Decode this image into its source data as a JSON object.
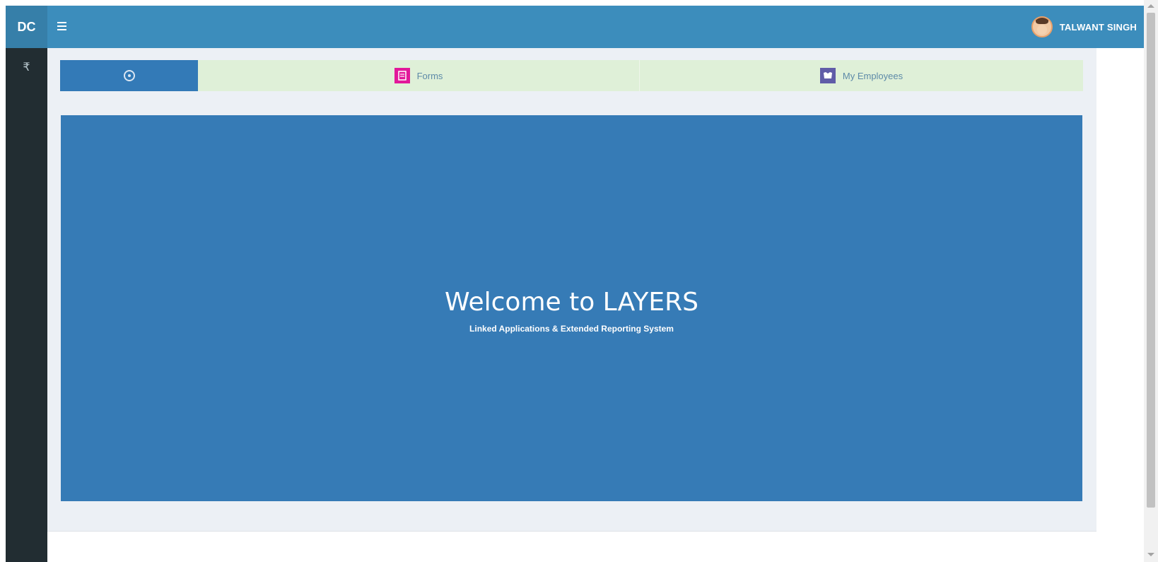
{
  "brand": {
    "logo": "DC"
  },
  "sidebar": {
    "items": [
      {
        "icon": "rupee-icon",
        "label": "₹"
      }
    ]
  },
  "topbar": {
    "menu_icon": "hamburger-icon",
    "user": {
      "name": "TALWANT SINGH",
      "avatar_icon": "user-avatar"
    }
  },
  "tabs": [
    {
      "icon": "dashboard-icon",
      "label": "",
      "active": true
    },
    {
      "icon": "form-icon",
      "label": "Forms",
      "icon_color": "#e2189a"
    },
    {
      "icon": "employees-icon",
      "label": "My Employees",
      "icon_color": "#605ca8"
    }
  ],
  "hero": {
    "title": "Welcome to LAYERS",
    "subtitle": "Linked Applications & Extended Reporting System"
  },
  "colors": {
    "topbar": "#3c8dbc",
    "sidebar": "#222d32",
    "hero": "#367bb6",
    "tab_inactive": "#dff0d8",
    "tab_active": "#337ab7"
  }
}
